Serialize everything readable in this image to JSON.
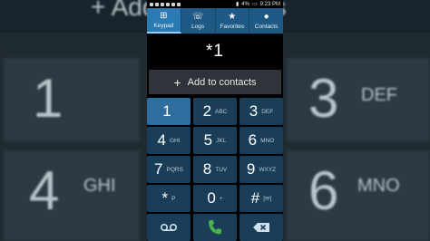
{
  "status_bar": {
    "time": "9:23 PM",
    "battery": "4%"
  },
  "tabs": [
    {
      "label": "Keypad",
      "icon": "keypad-icon",
      "active": true
    },
    {
      "label": "Logs",
      "icon": "logs-icon",
      "active": false
    },
    {
      "label": "Favorites",
      "icon": "star-icon",
      "active": false
    },
    {
      "label": "Contacts",
      "icon": "person-icon",
      "active": false
    }
  ],
  "dial_input": "*1",
  "add_to_contacts": "Add to contacts",
  "keys": [
    {
      "digit": "1",
      "letters": "",
      "selected": true
    },
    {
      "digit": "2",
      "letters": "ABC"
    },
    {
      "digit": "3",
      "letters": "DEF"
    },
    {
      "digit": "4",
      "letters": "GHI"
    },
    {
      "digit": "5",
      "letters": "JKL"
    },
    {
      "digit": "6",
      "letters": "MNO"
    },
    {
      "digit": "7",
      "letters": "PQRS"
    },
    {
      "digit": "8",
      "letters": "TUV"
    },
    {
      "digit": "9",
      "letters": "WXYZ"
    },
    {
      "digit": "*",
      "letters": "P"
    },
    {
      "digit": "0",
      "letters": "+"
    },
    {
      "digit": "#",
      "letters": "[✉]"
    }
  ],
  "actions": [
    {
      "icon": "voicemail-icon"
    },
    {
      "icon": "phone-call-icon",
      "color": "#4caf50"
    },
    {
      "icon": "backspace-icon"
    }
  ],
  "background": {
    "top_text": "+  Add to contacts",
    "left_digits": [
      {
        "digit": "1",
        "letters": ""
      },
      {
        "digit": "4",
        "letters": "GHI"
      }
    ],
    "right_digits": [
      {
        "digit": "3",
        "letters": "DEF"
      },
      {
        "digit": "6",
        "letters": "MNO"
      }
    ]
  }
}
